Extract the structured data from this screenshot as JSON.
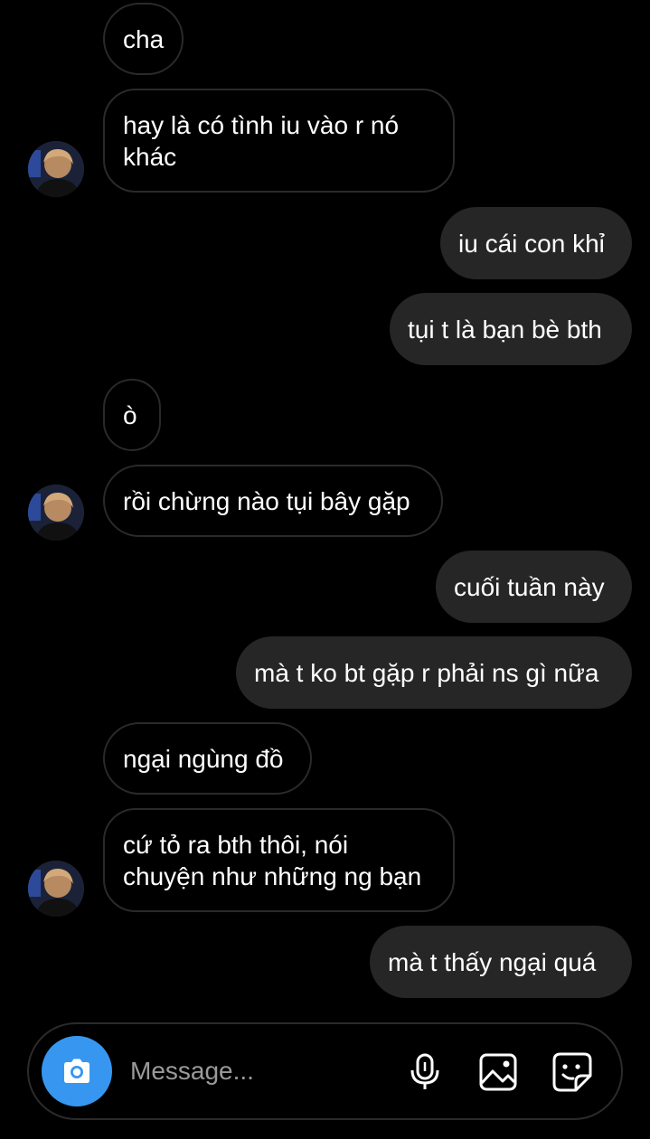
{
  "messages": [
    {
      "text": "cha"
    },
    {
      "text": "hay là có tình iu vào r nó\nkhác"
    },
    {
      "text": "iu cái con khỉ"
    },
    {
      "text": "tụi t là bạn bè bth"
    },
    {
      "text": "ò"
    },
    {
      "text": "rồi chừng nào tụi bây gặp"
    },
    {
      "text": "cuối tuần này"
    },
    {
      "text": "mà t ko bt gặp r phải ns gì nữa"
    },
    {
      "text": "ngại ngùng đồ"
    },
    {
      "text": "cứ tỏ ra bth thôi, nói\nchuyện như những ng bạn"
    },
    {
      "text": "mà t thấy ngại quá"
    }
  ],
  "composer": {
    "placeholder": "Message..."
  },
  "icons": {
    "camera": "camera-icon",
    "microphone": "microphone-icon",
    "gallery": "image-gallery-icon",
    "sticker": "sticker-icon",
    "avatar": "contact-avatar"
  },
  "colors": {
    "background": "#000000",
    "incoming_border": "#2a2a2a",
    "outgoing_bubble": "#262626",
    "accent": "#3797f0",
    "placeholder": "#9a9a9a"
  }
}
